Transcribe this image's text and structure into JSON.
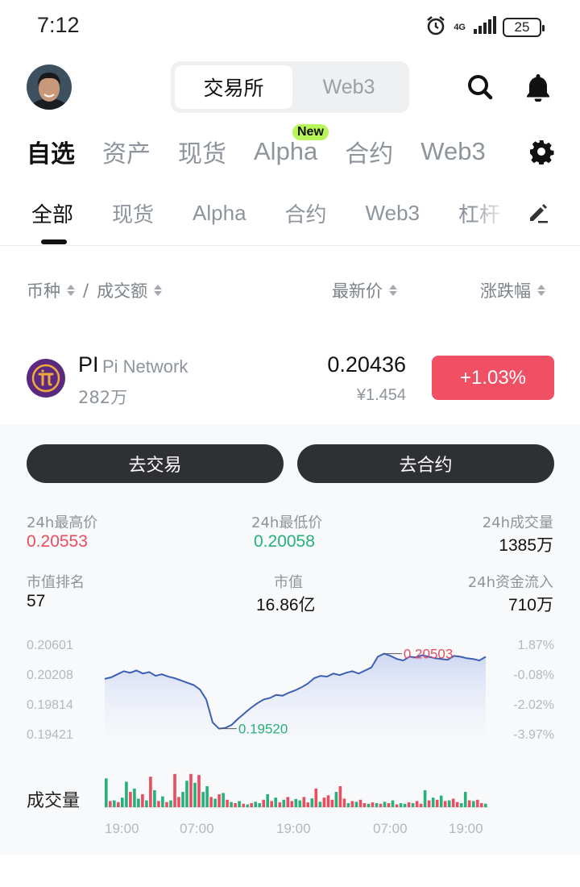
{
  "status_bar": {
    "time": "7:12",
    "network": "4G",
    "battery": "25"
  },
  "header": {
    "segment": {
      "active": "交易所",
      "inactive": "Web3"
    },
    "icons": [
      "search-icon",
      "bell-icon"
    ]
  },
  "main_tabs": [
    {
      "label": "自选",
      "active": true
    },
    {
      "label": "资产"
    },
    {
      "label": "现货"
    },
    {
      "label": "Alpha",
      "badge": "New"
    },
    {
      "label": "合约"
    },
    {
      "label": "Web3"
    }
  ],
  "sub_tabs": [
    {
      "label": "全部",
      "active": true
    },
    {
      "label": "现货"
    },
    {
      "label": "Alpha"
    },
    {
      "label": "合约"
    },
    {
      "label": "Web3"
    },
    {
      "label": "杠杆"
    }
  ],
  "columns": {
    "pair": "币种",
    "separator": "/",
    "turnover": "成交额",
    "last_price": "最新价",
    "change": "涨跌幅"
  },
  "coin": {
    "symbol": "PI",
    "name": "Pi Network",
    "turnover": "282万",
    "price": "0.20436",
    "price_cny": "¥1.454",
    "change": "+1.03%"
  },
  "actions": {
    "trade": "去交易",
    "contract": "去合约"
  },
  "stats": {
    "high_label": "24h最高价",
    "high": "0.20553",
    "low_label": "24h最低价",
    "low": "0.20058",
    "volume_label": "24h成交量",
    "volume": "1385万",
    "rank_label": "市值排名",
    "rank": "57",
    "mcap_label": "市值",
    "mcap": "16.86亿",
    "inflow_label": "24h资金流入",
    "inflow": "710万"
  },
  "colors": {
    "up": "#ea4c60",
    "down": "#26b07a",
    "line": "#3b5fb5"
  },
  "chart_data": {
    "type": "line",
    "y_left_ticks": [
      "0.20601",
      "0.20208",
      "0.19814",
      "0.19421"
    ],
    "y_right_ticks": [
      "1.87%",
      "-0.08%",
      "-2.02%",
      "-3.97%"
    ],
    "ylim": [
      0.19421,
      0.20601
    ],
    "x_ticks": [
      "19:00",
      "07:00",
      "19:00",
      "07:00",
      "19:00"
    ],
    "annotations": {
      "max": "0.20503",
      "min": "0.19520"
    },
    "price": [
      0.2017,
      0.2019,
      0.2023,
      0.2027,
      0.2025,
      0.2028,
      0.2024,
      0.2026,
      0.2021,
      0.2023,
      0.202,
      0.2018,
      0.2015,
      0.2012,
      0.2009,
      0.2003,
      0.199,
      0.196,
      0.1952,
      0.1953,
      0.1957,
      0.1965,
      0.1972,
      0.1979,
      0.1985,
      0.199,
      0.1992,
      0.1996,
      0.1995,
      0.1999,
      0.2002,
      0.2006,
      0.2011,
      0.2018,
      0.2021,
      0.202,
      0.2024,
      0.2022,
      0.2025,
      0.2027,
      0.2024,
      0.2028,
      0.2032,
      0.2046,
      0.205,
      0.2047,
      0.2043,
      0.2041,
      0.2046,
      0.2045,
      0.2048,
      0.2046,
      0.2044,
      0.2043,
      0.2042,
      0.2047,
      0.2046,
      0.2044,
      0.2043,
      0.2041,
      0.2046
    ],
    "volume_label": "成交量",
    "volume": [
      0.85,
      0.18,
      0.2,
      0.15,
      0.28,
      0.75,
      0.45,
      0.55,
      0.25,
      0.38,
      0.2,
      0.9,
      0.5,
      0.18,
      0.32,
      0.15,
      0.2,
      0.98,
      0.3,
      0.45,
      0.78,
      0.98,
      0.72,
      0.95,
      0.45,
      0.62,
      0.3,
      0.25,
      0.38,
      0.42,
      0.22,
      0.15,
      0.12,
      0.18,
      0.1,
      0.08,
      0.12,
      0.16,
      0.12,
      0.22,
      0.38,
      0.18,
      0.28,
      0.14,
      0.22,
      0.3,
      0.18,
      0.24,
      0.2,
      0.3,
      0.14,
      0.26,
      0.55,
      0.16,
      0.28,
      0.35,
      0.22,
      0.45,
      0.62,
      0.25,
      0.12,
      0.18,
      0.16,
      0.22,
      0.12,
      0.1,
      0.14,
      0.12,
      0.1,
      0.16,
      0.12,
      0.2,
      0.08,
      0.12,
      0.1,
      0.14,
      0.12,
      0.18,
      0.1,
      0.5,
      0.2,
      0.28,
      0.22,
      0.34,
      0.18,
      0.2,
      0.25,
      0.15,
      0.12,
      0.45,
      0.2,
      0.18,
      0.22,
      0.12,
      0.1
    ],
    "volume_up": [
      1,
      0,
      1,
      0,
      1,
      1,
      0,
      1,
      1,
      0,
      1,
      0,
      1,
      0,
      1,
      0,
      1,
      0,
      0,
      1,
      1,
      0,
      1,
      0,
      1,
      1,
      0,
      1,
      0,
      1,
      0,
      1,
      0,
      1,
      0,
      1,
      0,
      1,
      1,
      0,
      1,
      0,
      1,
      0,
      1,
      0,
      0,
      1,
      1,
      0,
      0,
      1,
      0,
      1,
      0,
      0,
      0,
      1,
      0,
      0,
      1,
      0,
      1,
      0,
      0,
      1,
      0,
      1,
      0,
      1,
      0,
      1,
      0,
      1,
      1,
      0,
      1,
      0,
      0,
      1,
      0,
      1,
      0,
      1,
      0,
      1,
      0,
      0,
      1,
      1,
      0,
      1,
      0,
      0,
      1
    ]
  }
}
